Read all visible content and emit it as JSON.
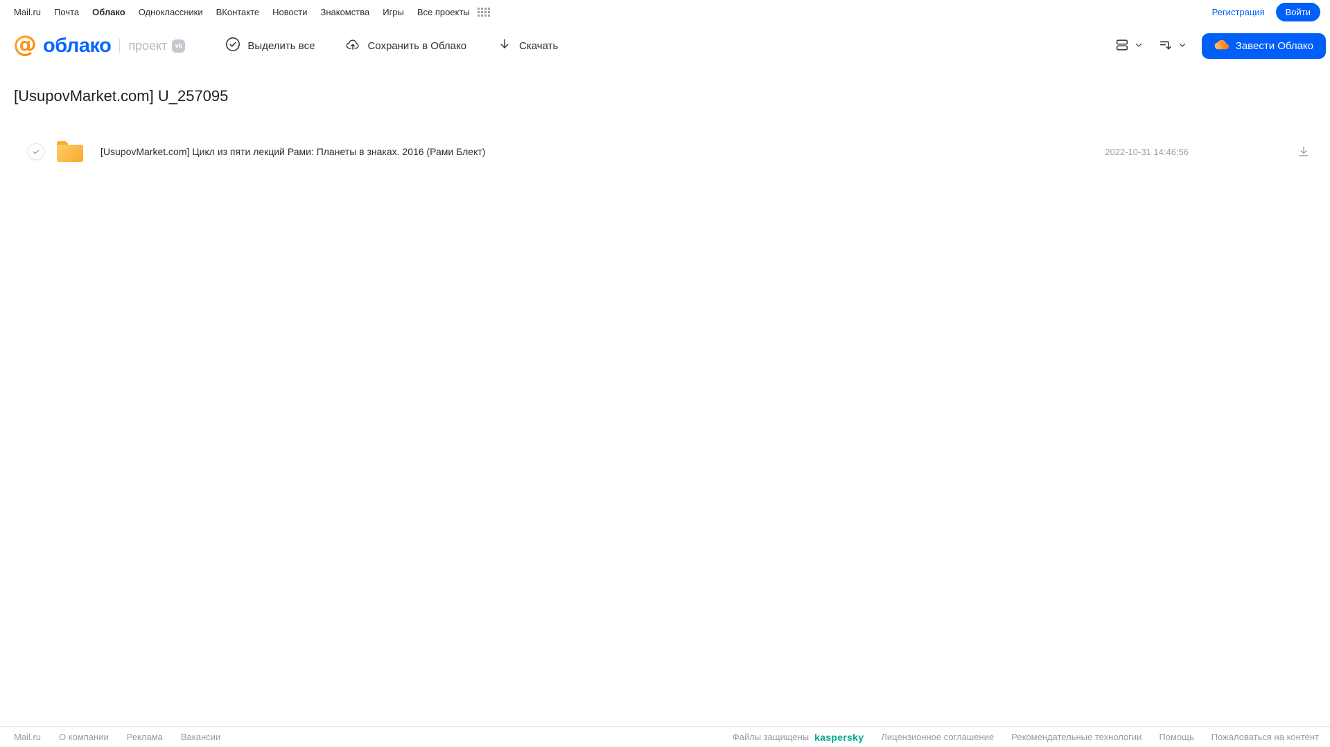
{
  "topnav": {
    "items": [
      {
        "label": "Mail.ru"
      },
      {
        "label": "Почта"
      },
      {
        "label": "Облако"
      },
      {
        "label": "Одноклассники"
      },
      {
        "label": "ВКонтакте"
      },
      {
        "label": "Новости"
      },
      {
        "label": "Знакомства"
      },
      {
        "label": "Игры"
      },
      {
        "label": "Все проекты"
      }
    ],
    "auth": {
      "register_label": "Регистрация",
      "login_label": "Войти"
    }
  },
  "header": {
    "logo": {
      "brand": "облако",
      "project_label": "проект",
      "vk_badge": "vk"
    },
    "toolbar": {
      "select_all": "Выделить все",
      "save_to_cloud": "Сохранить в Облако",
      "download": "Скачать"
    },
    "get_cloud_button": "Завести Облако"
  },
  "main": {
    "title": "[UsupovMarket.com] U_257095",
    "files": [
      {
        "type": "folder",
        "name": "[UsupovMarket.com] Цикл из пяти лекций Рами: Планеты в знаках. 2016 (Рами Блект)",
        "modified": "2022-10-31 14:46:56"
      }
    ]
  },
  "footer": {
    "left_links": [
      "Mail.ru",
      "О компании",
      "Реклама",
      "Вакансии"
    ],
    "protection_label": "Файлы защищены",
    "kaspersky_label": "kaspersky",
    "right_links": [
      "Лицензионное соглашение",
      "Рекомендательные технологии",
      "Помощь",
      "Пожаловаться на контент"
    ]
  },
  "colors": {
    "accent_blue": "#005FF9",
    "logo_blue": "#0667fe",
    "logo_orange": "#FF9E00",
    "folder_yellow": "#F8A928",
    "kaspersky_teal": "#00A88E",
    "muted_gray": "#9aa0a6"
  }
}
